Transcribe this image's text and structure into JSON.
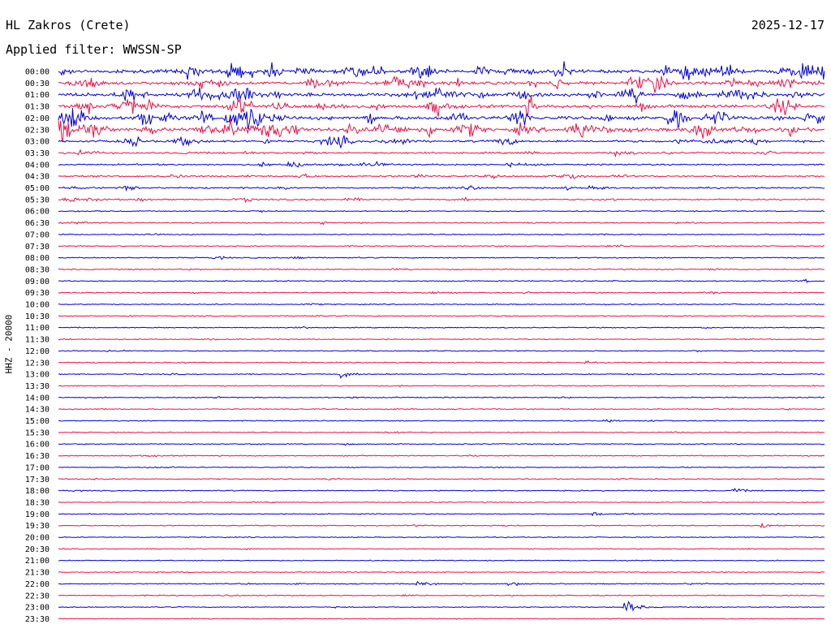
{
  "header": {
    "station": "HL Zakros (Crete)",
    "date": "2025-12-17",
    "filter": "Applied filter: WWSSN-SP"
  },
  "colors": {
    "trace_a": "#0000dd",
    "trace_b": "#ee1144"
  },
  "chart_data": {
    "type": "line",
    "ylabel": "HHZ - 20000",
    "y_tick_labels": [
      "00:00",
      "00:30",
      "01:00",
      "01:30",
      "02:00",
      "02:30",
      "03:00",
      "03:30",
      "04:00",
      "04:30",
      "05:00",
      "05:30",
      "06:00",
      "06:30",
      "07:00",
      "07:30",
      "08:00",
      "08:30",
      "09:00",
      "09:30",
      "10:00",
      "10:30",
      "11:00",
      "11:30",
      "12:00",
      "12:30",
      "13:00",
      "13:30",
      "14:00",
      "14:30",
      "15:00",
      "15:30",
      "16:00",
      "16:30",
      "17:00",
      "17:30",
      "18:00",
      "18:30",
      "19:00",
      "19:30",
      "20:00",
      "20:30",
      "21:00",
      "21:30",
      "22:00",
      "22:30",
      "23:00",
      "23:30"
    ],
    "trace_colors": [
      "blue",
      "red"
    ],
    "row_activity": [
      1.0,
      0.85,
      0.9,
      0.85,
      1.0,
      1.0,
      0.55,
      0.35,
      0.3,
      0.3,
      0.3,
      0.25,
      0.12,
      0.15,
      0.12,
      0.12,
      0.15,
      0.15,
      0.15,
      0.15,
      0.1,
      0.12,
      0.1,
      0.12,
      0.12,
      0.12,
      0.12,
      0.12,
      0.12,
      0.12,
      0.1,
      0.1,
      0.1,
      0.1,
      0.1,
      0.1,
      0.12,
      0.1,
      0.08,
      0.1,
      0.08,
      0.08,
      0.06,
      0.06,
      0.12,
      0.1,
      0.08,
      0.06
    ],
    "events": [
      {
        "row": 2,
        "x": 0.495,
        "amp": 3.5
      },
      {
        "row": 3,
        "x": 0.49,
        "amp": 2.0
      },
      {
        "row": 5,
        "x": 0.6,
        "amp": 1.6
      },
      {
        "row": 11,
        "x": 0.01,
        "amp": 0.8
      },
      {
        "row": 26,
        "x": 0.37,
        "amp": 0.9
      },
      {
        "row": 36,
        "x": 0.88,
        "amp": 0.7
      },
      {
        "row": 38,
        "x": 0.7,
        "amp": 0.5
      },
      {
        "row": 39,
        "x": 0.92,
        "amp": 0.5
      },
      {
        "row": 44,
        "x": 0.47,
        "amp": 0.7
      },
      {
        "row": 44,
        "x": 0.59,
        "amp": 0.6
      },
      {
        "row": 46,
        "x": 0.74,
        "amp": 2.2
      }
    ]
  }
}
